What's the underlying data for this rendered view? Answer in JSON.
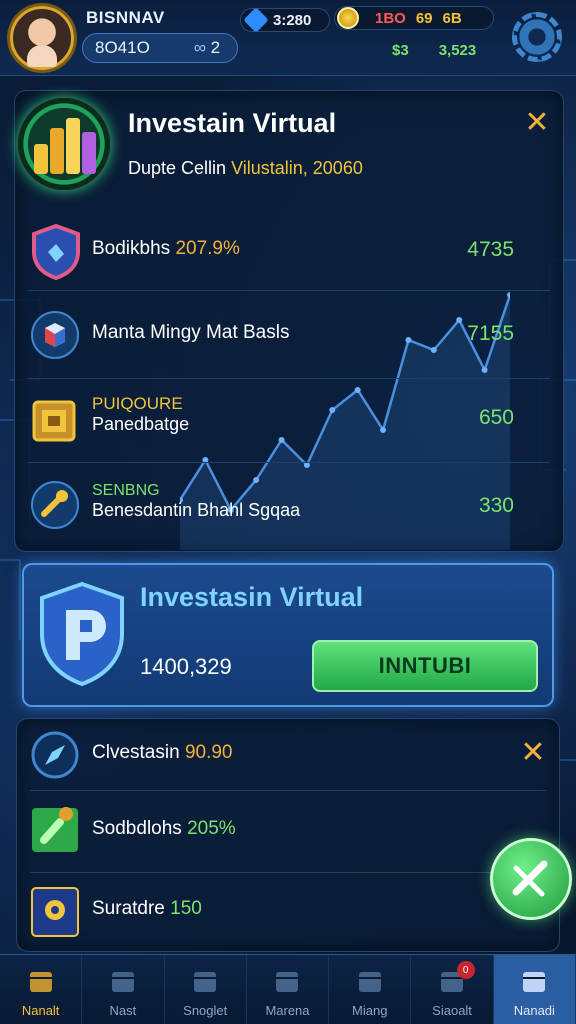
{
  "player": {
    "name": "BISNNAV",
    "id": "8O41O",
    "level": "2"
  },
  "resources": {
    "gems": "3:280",
    "red": "1BO",
    "gold": "69",
    "yellow": "6B",
    "green_a": "$3",
    "green_b": "3,523"
  },
  "invest_panel": {
    "title": "Investain Virtual",
    "subtitle_prefix": "Dupte Cellin",
    "subtitle_highlight": "Vilustalin, 20060",
    "rows": [
      {
        "label": "Bodikbhs",
        "highlight": "207.9%",
        "value": "4735",
        "icon": "shield-icon"
      },
      {
        "label": "Manta Mingy Mat Basls",
        "highlight": "",
        "value": "7155",
        "icon": "cube-icon"
      },
      {
        "label_top": "PUIQOURE",
        "label": "Panedbatge",
        "value": "650",
        "icon": "chest-icon"
      },
      {
        "label_top": "SENBNG",
        "label": "Benesdantin Bhahl Sgqaa",
        "value": "330",
        "icon": "tool-icon"
      }
    ],
    "chart_points": [
      50,
      90,
      40,
      70,
      110,
      85,
      140,
      160,
      120,
      210,
      200,
      230,
      180,
      255
    ]
  },
  "banner": {
    "title": "Investasin Virtual",
    "amount": "1400,329",
    "button_label": "INNTUBI"
  },
  "lower_panel": {
    "rows": [
      {
        "label": "Clvestasin",
        "highlight": "90.90",
        "icon": "compass-icon"
      },
      {
        "label": "Sodbdlohs",
        "highlight": "205%",
        "icon": "bottle-icon"
      },
      {
        "label": "Suratdre",
        "highlight": "150",
        "icon": "book-icon"
      }
    ]
  },
  "nav": [
    {
      "label": "Nanalt",
      "icon": "box-icon"
    },
    {
      "label": "Nast",
      "icon": "gear-icon"
    },
    {
      "label": "Snoglet",
      "icon": "crate-icon"
    },
    {
      "label": "Marena",
      "icon": "search-icon"
    },
    {
      "label": "Miang",
      "icon": "shop-icon"
    },
    {
      "label": "Siaoalt",
      "icon": "mail-icon",
      "badge": "0"
    },
    {
      "label": "Nanadi",
      "icon": "house-icon"
    }
  ],
  "colors": {
    "accent_green": "#7be36a",
    "accent_gold": "#f2c43c",
    "banner_blue": "#1b4a8e"
  }
}
